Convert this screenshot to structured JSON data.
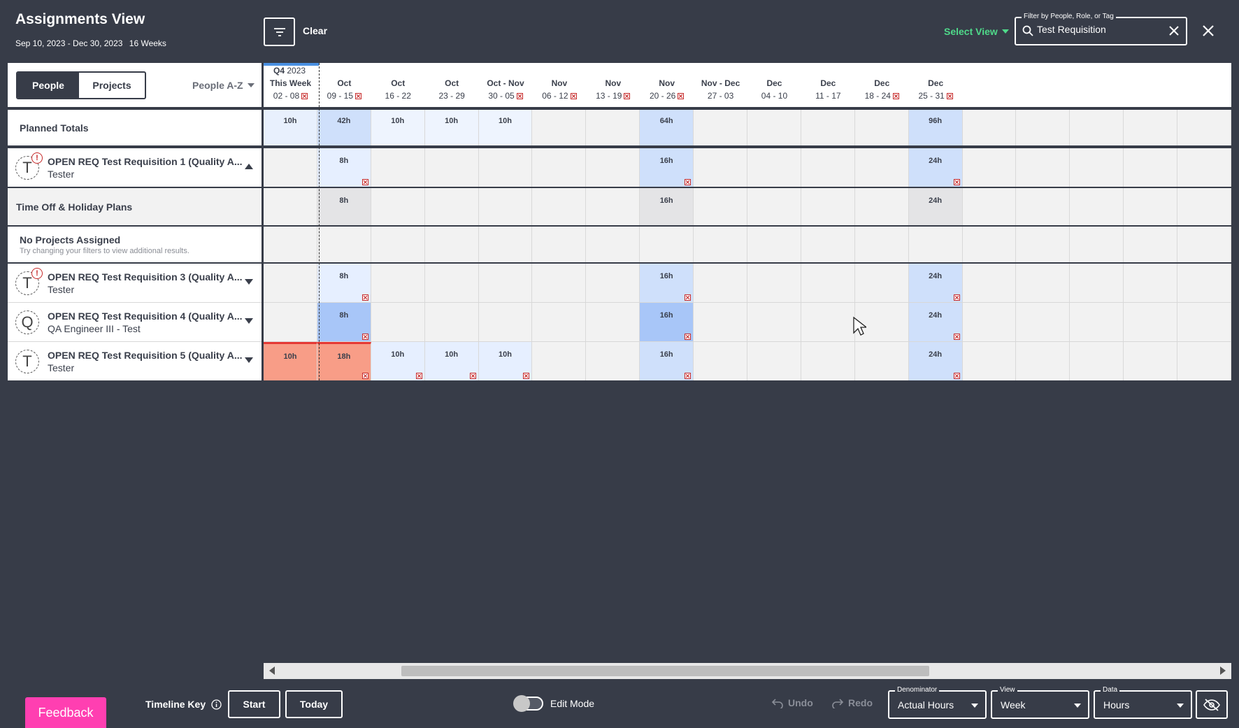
{
  "header": {
    "title": "Assignments View",
    "date_range": "Sep 10, 2023 - Dec 30, 2023",
    "weeks": "16 Weeks",
    "clear_label": "Clear",
    "select_view_label": "Select View",
    "search_legend": "Filter by People, Role, or Tag",
    "search_value": "Test Requisition"
  },
  "left": {
    "toggle_people": "People",
    "toggle_projects": "Projects",
    "sort_label": "People A-Z",
    "planned_totals": "Planned Totals",
    "time_off": "Time Off & Holiday Plans",
    "no_projects": "No Projects Assigned",
    "no_projects_sub": "Try changing your filters to view additional results.",
    "people": [
      {
        "initial": "T",
        "name": "OPEN REQ Test Requisition 1 (Quality A...",
        "role": "Tester",
        "alert": "!",
        "expanded": true
      },
      {
        "initial": "T",
        "name": "OPEN REQ Test Requisition 3 (Quality A...",
        "role": "Tester",
        "alert": "!",
        "expanded": false
      },
      {
        "initial": "Q",
        "name": "OPEN REQ Test Requisition 4 (Quality A...",
        "role": "QA Engineer III - Test",
        "alert": "",
        "expanded": false
      },
      {
        "initial": "T",
        "name": "OPEN REQ Test Requisition 5 (Quality A...",
        "role": "Tester",
        "alert": "",
        "expanded": false
      }
    ]
  },
  "grid": {
    "quarter": "Q4",
    "quarter_year": "2023",
    "weeks": [
      {
        "month": "This Week",
        "days": "02 - 08",
        "holiday": true
      },
      {
        "month": "Oct",
        "days": "09 - 15",
        "holiday": true
      },
      {
        "month": "Oct",
        "days": "16 - 22",
        "holiday": false
      },
      {
        "month": "Oct",
        "days": "23 - 29",
        "holiday": false
      },
      {
        "month": "Oct - Nov",
        "days": "30 - 05",
        "holiday": true
      },
      {
        "month": "Nov",
        "days": "06 - 12",
        "holiday": true
      },
      {
        "month": "Nov",
        "days": "13 - 19",
        "holiday": true
      },
      {
        "month": "Nov",
        "days": "20 - 26",
        "holiday": true
      },
      {
        "month": "Nov - Dec",
        "days": "27 - 03",
        "holiday": false
      },
      {
        "month": "Dec",
        "days": "04 - 10",
        "holiday": false
      },
      {
        "month": "Dec",
        "days": "11 - 17",
        "holiday": false
      },
      {
        "month": "Dec",
        "days": "18 - 24",
        "holiday": true
      },
      {
        "month": "Dec",
        "days": "25 - 31",
        "holiday": true
      },
      {
        "month": "",
        "days": "",
        "holiday": false
      },
      {
        "month": "",
        "days": "",
        "holiday": false
      },
      {
        "month": "",
        "days": "",
        "holiday": false
      },
      {
        "month": "",
        "days": "",
        "holiday": false
      },
      {
        "month": "",
        "days": "",
        "holiday": false
      }
    ],
    "planned_totals": [
      "10h",
      "42h",
      "10h",
      "10h",
      "10h",
      "",
      "",
      "64h",
      "",
      "",
      "",
      "",
      "96h",
      "",
      "",
      "",
      "",
      ""
    ],
    "rows": {
      "p1": [
        "",
        "8h",
        "",
        "",
        "",
        "",
        "",
        "16h",
        "",
        "",
        "",
        "",
        "24h",
        "",
        "",
        "",
        "",
        ""
      ],
      "timeoff": [
        "",
        "8h",
        "",
        "",
        "",
        "",
        "",
        "16h",
        "",
        "",
        "",
        "",
        "24h",
        "",
        "",
        "",
        "",
        ""
      ],
      "noproj": [
        "",
        "",
        "",
        "",
        "",
        "",
        "",
        "",
        "",
        "",
        "",
        "",
        "",
        "",
        "",
        "",
        "",
        ""
      ],
      "p3": [
        "",
        "8h",
        "",
        "",
        "",
        "",
        "",
        "16h",
        "",
        "",
        "",
        "",
        "24h",
        "",
        "",
        "",
        "",
        ""
      ],
      "p4": [
        "",
        "8h",
        "",
        "",
        "",
        "",
        "",
        "16h",
        "",
        "",
        "",
        "",
        "24h",
        "",
        "",
        "",
        "",
        ""
      ],
      "p5": [
        "10h",
        "18h",
        "10h",
        "10h",
        "10h",
        "",
        "",
        "16h",
        "",
        "",
        "",
        "",
        "24h",
        "",
        "",
        "",
        "",
        ""
      ]
    }
  },
  "footer": {
    "feedback": "Feedback",
    "timeline_key": "Timeline Key",
    "start": "Start",
    "today": "Today",
    "edit_mode": "Edit Mode",
    "undo": "Undo",
    "redo": "Redo",
    "denominator_label": "Denominator",
    "denominator_value": "Actual Hours",
    "view_label": "View",
    "view_value": "Week",
    "data_label": "Data",
    "data_value": "Hours"
  },
  "colors": {
    "background": "#373c48",
    "accent_green": "#4fd98a",
    "feedback_pink": "#ff3fb1",
    "light_blue": "#cfe0fb",
    "mid_blue": "#a8c6f8",
    "over_red": "#f89d87",
    "alert_red": "#c62828"
  }
}
